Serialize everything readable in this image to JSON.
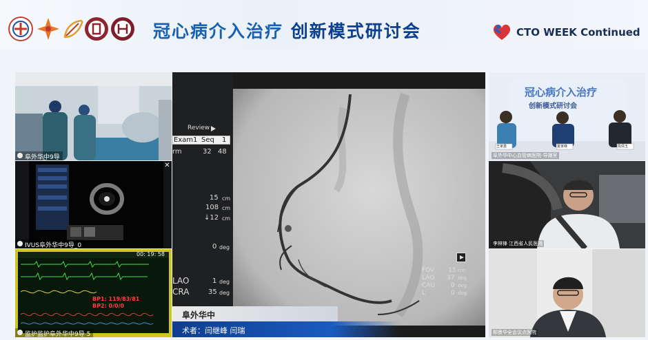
{
  "banner": {
    "title_a": "冠心病介入治疗",
    "title_b": "创新模式研讨会",
    "brand": "CTO WEEK Continued"
  },
  "tiles": {
    "cathlab": "阜外华中9导",
    "ivus": "IVUS阜外华中9导_0",
    "monitor": "监护监护阜外华中9导 5",
    "studio": "阜外华中心血管病医院-导播室",
    "doc1": "李林锋 江西省人民医院",
    "doc2": "柳景华全会议点医院"
  },
  "angio": {
    "review": "Review",
    "exam": "Exam",
    "exam_n": "1",
    "seq": "Seq",
    "seq_n": "1",
    "frm": "rm",
    "frm_cur": "32",
    "frm_total": "48",
    "d1": "15",
    "d2": "108",
    "d3": "↓12",
    "unit_cm": "cm",
    "deg0": "0",
    "unit_deg": "deg",
    "lao_label": "LAO",
    "lao_val": "1",
    "cra_label": "CRA",
    "cra_val": "35",
    "fov_label": "FOV",
    "fov_val": "15",
    "lao2_label": "LAO",
    "lao2_val": "37",
    "cau_label": "CAU",
    "cau_val": "0",
    "l_label": "L",
    "l_val": "0",
    "caption_top": "阜外华中",
    "caption_bottom": "术者：闫继峰  闫瑞"
  },
  "monitor": {
    "time": "00: 19: 58",
    "bp1": "BP1: 119/83/81",
    "bp2": "BP2: 0/0/0"
  },
  "studio_plates": [
    "王家勇",
    "夏家峰",
    "陈倩玉"
  ],
  "studio_backdrop": "冠心病介入治疗",
  "studio_backdrop2": "创新模式研讨会"
}
